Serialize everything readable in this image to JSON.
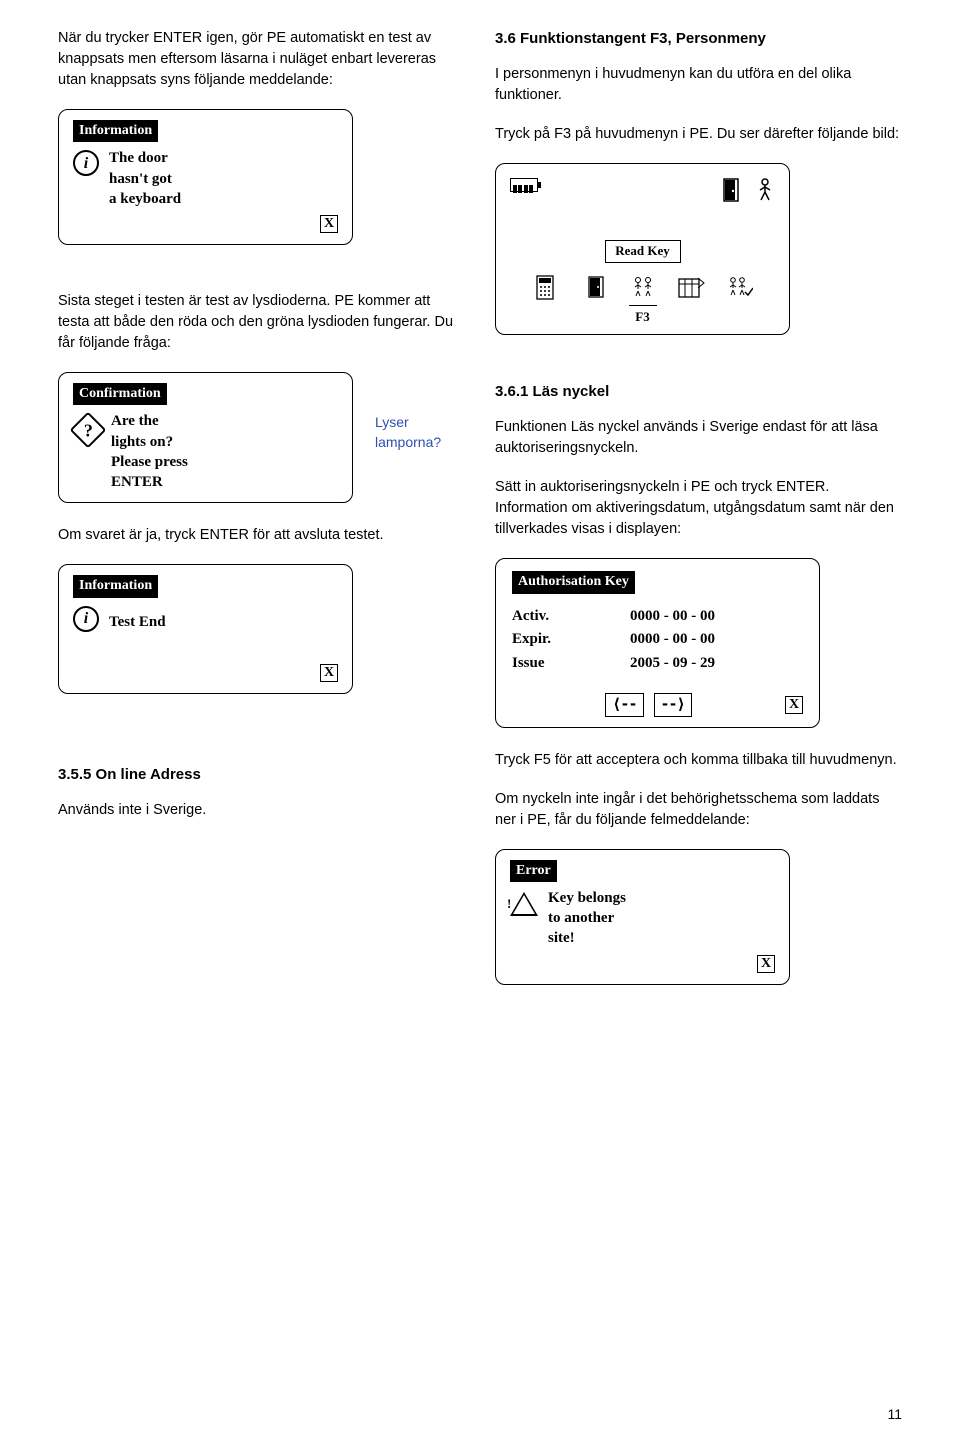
{
  "left": {
    "p1": "När du trycker ENTER igen, gör PE automatiskt en test av knappsats men eftersom läsarna i nuläget enbart levereras utan knappsats syns följande meddelande:",
    "scr1": {
      "title": "Information",
      "l1": "The door",
      "l2": "hasn't got",
      "l3": "a keyboard",
      "x": "X"
    },
    "p2": "Sista steget i testen är test av lysdioderna. PE kommer att testa att både den röda och den gröna lysdioden fungerar. Du får följande fråga:",
    "scr2": {
      "title": "Confirmation",
      "l1": "Are the",
      "l2": "lights on?",
      "l3": "Please press",
      "l4": "ENTER"
    },
    "lyser1": "Lyser",
    "lyser2": "lamporna?",
    "p3": "Om svaret är ja, tryck ENTER för att avsluta testet.",
    "scr3": {
      "title": "Information",
      "l1": "Test End",
      "x": "X"
    },
    "h355": "3.5.5 On line Adress",
    "p4": "Används inte i Sverige."
  },
  "right": {
    "h36": "3.6 Funktionstangent F3, Personmeny",
    "p1a": "I personmenyn i huvudmenyn kan du utföra en del olika funktioner.",
    "p1b": "Tryck på F3 på huvudmenyn i PE. Du ser därefter följande bild:",
    "readkey": {
      "btn": "Read Key",
      "f3": "F3"
    },
    "h361": "3.6.1 Läs nyckel",
    "p2a": "Funktionen Läs nyckel används i Sverige endast för att läsa auktoriseringsnyckeln.",
    "p2b": "Sätt in auktoriseringsnyckeln i PE och tryck ENTER. Information om aktiveringsdatum, utgångsdatum samt när den tillverkades visas i displayen:",
    "auth": {
      "title": "Authorisation Key",
      "activ": "Activ.",
      "activ_v": "0000 - 00 - 00",
      "expir": "Expir.",
      "expir_v": "0000 - 00 - 00",
      "issue": "Issue",
      "issue_v": "2005 - 09 - 29",
      "arrL": "⟨--",
      "arrR": "--⟩",
      "x": "X"
    },
    "p3": "Tryck F5 för att acceptera och komma tillbaka till huvudmenyn.",
    "p4": "Om nyckeln inte ingår i det behörighetsschema som laddats ner i PE, får du följande felmeddelande:",
    "err": {
      "title": "Error",
      "l1": "Key belongs",
      "l2": "to another",
      "l3": "site!",
      "x": "X"
    }
  },
  "page": "11"
}
